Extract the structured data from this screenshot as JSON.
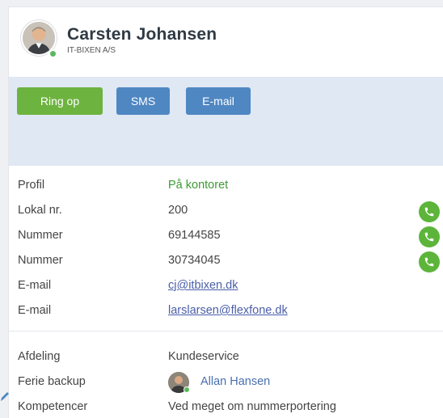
{
  "contact": {
    "name": "Carsten Johansen",
    "company": "IT-BIXEN A/S"
  },
  "actions": {
    "call_label": "Ring op",
    "sms_label": "SMS",
    "email_label": "E-mail",
    "colors": {
      "call": "#6db33f",
      "secondary": "#4f87c2"
    }
  },
  "details": [
    {
      "label": "Profil",
      "value": "På kontoret",
      "phone": false
    },
    {
      "label": "Lokal nr.",
      "value": "200",
      "phone": true
    },
    {
      "label": "Nummer",
      "value": "69144585",
      "phone": true
    },
    {
      "label": "Nummer",
      "value": "30734045",
      "phone": true
    },
    {
      "label": "E-mail",
      "value": "cj@itbixen.dk",
      "phone": false
    },
    {
      "label": "E-mail",
      "value": "larslarsen@flexfone.dk",
      "phone": false
    }
  ],
  "info": {
    "department_label": "Afdeling",
    "department_value": "Kundeservice",
    "backup_label": "Ferie backup",
    "backup_value": "Allan Hansen",
    "competence_label": "Kompetencer",
    "competence_value": "Ved meget om nummerportering"
  }
}
